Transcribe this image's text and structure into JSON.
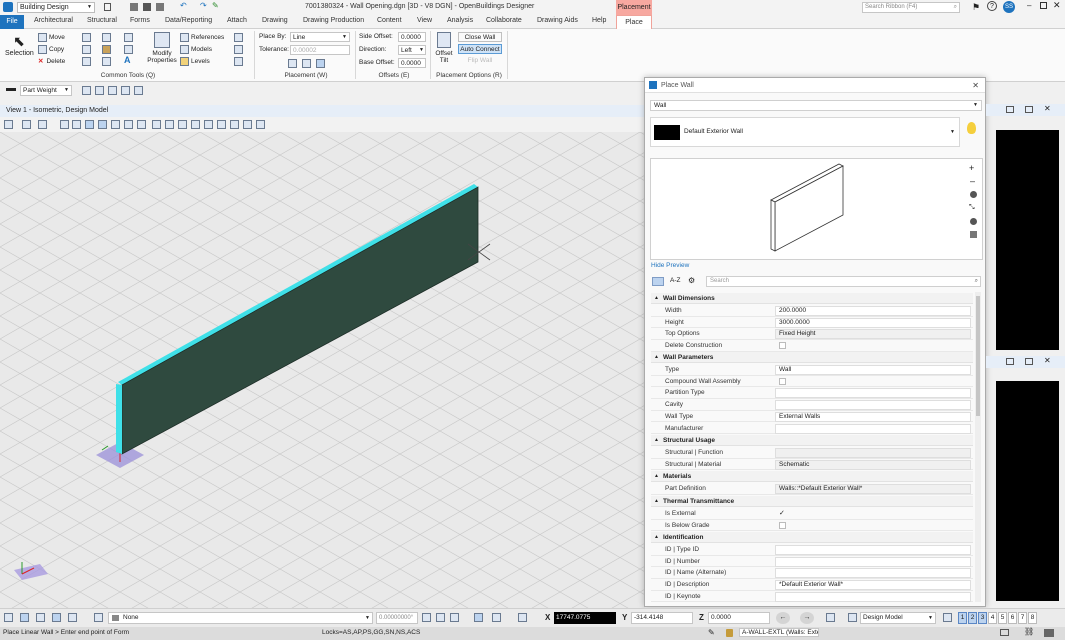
{
  "app": {
    "workflow": "Building Design",
    "title": "7001380324 - Wall Opening.dgn [3D - V8 DGN] - OpenBuildings Designer",
    "contextual_group": "Placement",
    "search_placeholder": "Search Ribbon (F4)"
  },
  "ribbon_tabs": [
    "File",
    "Architectural",
    "Structural",
    "Forms",
    "Data/Reporting",
    "Attach",
    "Drawing",
    "Drawing Production",
    "Content",
    "View",
    "Analysis",
    "Collaborate",
    "Drawing Aids",
    "Help",
    "Place"
  ],
  "ribbon": {
    "selection": "Selection",
    "move": "Move",
    "copy": "Copy",
    "delete": "Delete",
    "modify_properties": "Modify Properties",
    "references": "References",
    "models": "Models",
    "levels": "Levels",
    "common_tools": "Common Tools (Q)",
    "place_by_label": "Place By:",
    "place_by_value": "Line",
    "tolerance_label": "Tolerance:",
    "tolerance_value": "0.00002",
    "placement_group": "Placement (W)",
    "side_offset_label": "Side Offset:",
    "side_offset_value": "0.0000",
    "direction_label": "Direction:",
    "direction_value": "Left",
    "base_offset_label": "Base Offset:",
    "base_offset_value": "0.0000",
    "offsets_group": "Offsets (E)",
    "offset_tilt": "Offset Tilt",
    "close_wall": "Close Wall",
    "auto_connect": "Auto Connect",
    "flip_wall": "Flip Wall",
    "placement_options_group": "Placement Options (R)"
  },
  "toolbar2": {
    "weight": "Part Weight"
  },
  "view": {
    "title": "View 1 - Isometric, Design Model"
  },
  "panel": {
    "title": "Place Wall",
    "type_dropdown": "Wall",
    "style_name": "Default Exterior Wall",
    "hide_preview": "Hide Preview",
    "sort_az": "A-Z",
    "search_placeholder": "Search",
    "sections": [
      {
        "name": "Wall Dimensions",
        "rows": [
          {
            "label": "Width",
            "value": "200.0000"
          },
          {
            "label": "Height",
            "value": "3000.0000"
          },
          {
            "label": "Top Options",
            "value": "Fixed Height"
          },
          {
            "label": "Delete Construction",
            "value": ""
          }
        ]
      },
      {
        "name": "Wall Parameters",
        "rows": [
          {
            "label": "Type",
            "value": "Wall"
          },
          {
            "label": "Compound Wall Assembly",
            "value": ""
          },
          {
            "label": "Partition Type",
            "value": ""
          },
          {
            "label": "Cavity",
            "value": ""
          },
          {
            "label": "Wall Type",
            "value": "External Walls"
          },
          {
            "label": "Manufacturer",
            "value": ""
          }
        ]
      },
      {
        "name": "Structural Usage",
        "rows": [
          {
            "label": "Structural | Function",
            "value": ""
          },
          {
            "label": "Structural | Material",
            "value": "Schematic"
          }
        ]
      },
      {
        "name": "Materials",
        "rows": [
          {
            "label": "Part Definition",
            "value": "Walls::*Default Exterior Wall*"
          }
        ]
      },
      {
        "name": "Thermal Transmittance",
        "rows": [
          {
            "label": "Is External",
            "value": "✓"
          },
          {
            "label": "Is Below Grade",
            "value": ""
          }
        ]
      },
      {
        "name": "Identification",
        "rows": [
          {
            "label": "ID | Type ID",
            "value": ""
          },
          {
            "label": "ID | Number",
            "value": ""
          },
          {
            "label": "ID | Name (Alternate)",
            "value": ""
          },
          {
            "label": "ID | Description",
            "value": "*Default Exterior Wall*"
          },
          {
            "label": "ID | Keynote",
            "value": ""
          }
        ]
      }
    ]
  },
  "status": {
    "level": "None",
    "scale": "0.00000000°",
    "x_label": "X",
    "x_value": "17747.0775",
    "y_label": "Y",
    "y_value": "-314.4148",
    "z_label": "Z",
    "z_value": "0.0000",
    "model": "Design Model",
    "view_numbers": [
      "1",
      "2",
      "3",
      "4",
      "5",
      "6",
      "7",
      "8"
    ]
  },
  "footer": {
    "prompt": "Place Linear Wall > Enter end point of Form",
    "locks": "Locks=AS,AP,PS,GG,SN,NS,ACS",
    "level_name": "A-WALL-EXTL (Walls: Exte"
  },
  "colors": {
    "accent": "#1e73be",
    "placement_tab": "#f7a8a0",
    "wall_face": "#2f4a3f",
    "wall_edge": "#3fe0e8"
  }
}
